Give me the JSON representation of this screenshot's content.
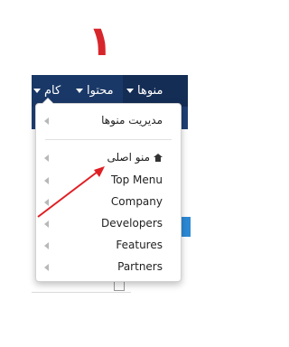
{
  "annotation": {
    "step_number": "۱",
    "color": "#d7262b"
  },
  "navbar": {
    "items": [
      {
        "label": "منوها"
      },
      {
        "label": "محتوا"
      },
      {
        "label": "کام"
      }
    ]
  },
  "dropdown": {
    "header": {
      "label": "مدیریت منوها"
    },
    "items": [
      {
        "label": "منو اصلی",
        "icon": "home-icon"
      },
      {
        "label": "Top Menu"
      },
      {
        "label": "Company"
      },
      {
        "label": "Developers"
      },
      {
        "label": "Features"
      },
      {
        "label": "Partners"
      }
    ]
  },
  "colors": {
    "navbar_bg": "#1a3867",
    "accent": "#2d89d4"
  }
}
